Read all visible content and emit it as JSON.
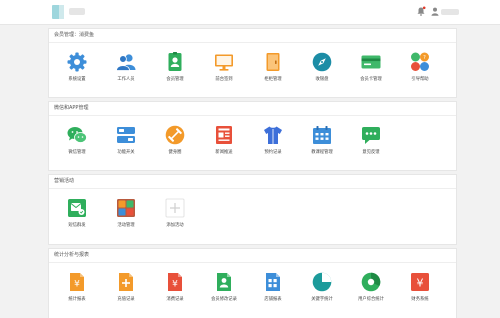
{
  "sections": {
    "member": {
      "title": "会员管理：消费鱼",
      "items": [
        {
          "label": "系统设置",
          "icon": "gear-icon"
        },
        {
          "label": "工作人员",
          "icon": "users-icon"
        },
        {
          "label": "会员管理",
          "icon": "member-card-icon"
        },
        {
          "label": "前台签到",
          "icon": "monitor-icon"
        },
        {
          "label": "柜柜管理",
          "icon": "cabinet-icon"
        },
        {
          "label": "收银盘",
          "icon": "compass-icon"
        },
        {
          "label": "会员卡管理",
          "icon": "card-icon"
        },
        {
          "label": "引导帮助",
          "icon": "help-icon"
        }
      ]
    },
    "wechat": {
      "title": "微信和APP管理",
      "items": [
        {
          "label": "微信管理",
          "icon": "wechat-icon"
        },
        {
          "label": "功能开关",
          "icon": "toggle-icon"
        },
        {
          "label": "健身圈",
          "icon": "dumbbell-icon"
        },
        {
          "label": "新闻推送",
          "icon": "news-icon"
        },
        {
          "label": "预约记录",
          "icon": "shirt-icon"
        },
        {
          "label": "教课程管理",
          "icon": "calendar-icon"
        },
        {
          "label": "意见反馈",
          "icon": "feedback-icon"
        }
      ]
    },
    "marketing": {
      "title": "营销活动",
      "items": [
        {
          "label": "短信群发",
          "icon": "sms-icon"
        },
        {
          "label": "活动管理",
          "icon": "activity-icon"
        },
        {
          "label": "添加活动",
          "icon": "add-icon"
        }
      ]
    },
    "stats": {
      "title": "统计分析与报表",
      "items": [
        {
          "label": "统计报表",
          "icon": "yen-doc-icon"
        },
        {
          "label": "充值记录",
          "icon": "recharge-icon"
        },
        {
          "label": "消费记录",
          "icon": "consume-icon"
        },
        {
          "label": "会员修改记录",
          "icon": "member-edit-icon"
        },
        {
          "label": "店铺报表",
          "icon": "store-report-icon"
        },
        {
          "label": "关键字统计",
          "icon": "keyword-pie-icon"
        },
        {
          "label": "用户综合统计",
          "icon": "user-pie-icon"
        },
        {
          "label": "财务系统",
          "icon": "finance-icon"
        }
      ]
    }
  },
  "colors": {
    "blue": "#3d8ed9",
    "green": "#2fae5c",
    "orange": "#f39a2a",
    "red": "#e8503a",
    "teal": "#1c9b9b"
  }
}
